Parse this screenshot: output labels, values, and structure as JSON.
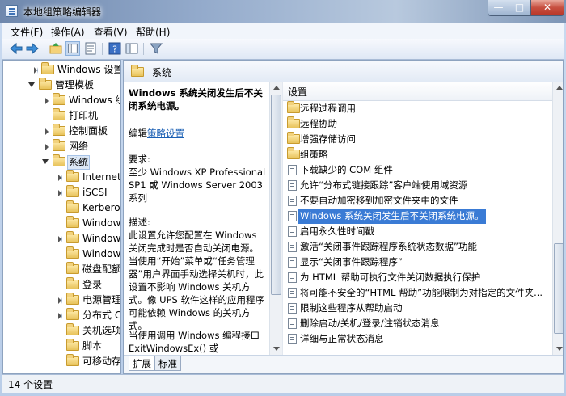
{
  "window": {
    "title": "本地组策略编辑器"
  },
  "menu": [
    {
      "label": "文件(F)"
    },
    {
      "label": "操作(A)"
    },
    {
      "label": "查看(V)"
    },
    {
      "label": "帮助(H)"
    }
  ],
  "toolbar": {
    "icons": [
      "back-arrow-icon",
      "forward-arrow-icon",
      "up-folder-icon",
      "show-tree-icon",
      "properties-icon",
      "help-icon",
      "extended-view-icon",
      "filter-icon"
    ]
  },
  "tree": {
    "items": [
      {
        "label": "Windows 设置",
        "expanded": false
      },
      {
        "label": "管理模板",
        "expanded": true
      },
      {
        "label": "Windows 组件"
      },
      {
        "label": "打印机"
      },
      {
        "label": "控制面板"
      },
      {
        "label": "网络"
      },
      {
        "label": "系统",
        "selected": true
      },
      {
        "label": "Internet 通信管理"
      },
      {
        "label": "iSCSI"
      },
      {
        "label": "Kerberos"
      },
      {
        "label": "Windows 文件保护"
      },
      {
        "label": "Windows 时间服务"
      },
      {
        "label": "Windows HotStart"
      },
      {
        "label": "磁盘配额"
      },
      {
        "label": "登录"
      },
      {
        "label": "电源管理"
      },
      {
        "label": "分布式 COM"
      },
      {
        "label": "关机选项"
      },
      {
        "label": "脚本"
      },
      {
        "label": "可移动存储访问"
      }
    ]
  },
  "content": {
    "header": "系统",
    "description": {
      "title": "Windows 系统关闭发生后不关闭系统电源。",
      "edit_prefix": "编辑",
      "edit_link": "策略设置",
      "req_label": "要求:",
      "req_text": "至少 Windows XP Professional SP1 或 Windows Server 2003 系列",
      "desc_label": "描述:",
      "desc_text": "此设置允许您配置在 Windows 关闭完成时是否自动关闭电源。当使用“开始”菜单或“任务管理器”用户界面手动选择关机时，此设置不影响 Windows 关机方式。像 UPS 软件这样的应用程序可能依赖 Windows 的关机方式。",
      "extra_text": "当使用调用 Windows 编程接口 ExitWindowsEx() 或 InitiateSystemShutdown() 的软件"
    },
    "list_header": "设置",
    "settings": [
      {
        "type": "folder",
        "label": "远程过程调用"
      },
      {
        "type": "folder",
        "label": "远程协助"
      },
      {
        "type": "folder",
        "label": "增强存储访问"
      },
      {
        "type": "folder",
        "label": "组策略"
      },
      {
        "type": "policy",
        "label": "下载缺少的 COM 组件"
      },
      {
        "type": "policy",
        "label": "允许“分布式链接跟踪”客户端使用域资源"
      },
      {
        "type": "policy",
        "label": "不要自动加密移到加密文件夹中的文件"
      },
      {
        "type": "policy",
        "label": "Windows 系统关闭发生后不关闭系统电源。",
        "selected": true
      },
      {
        "type": "policy",
        "label": "启用永久性时间戳"
      },
      {
        "type": "policy",
        "label": "激活“关闭事件跟踪程序系统状态数据”功能"
      },
      {
        "type": "policy",
        "label": "显示“关闭事件跟踪程序”"
      },
      {
        "type": "policy",
        "label": "为 HTML 帮助可执行文件关闭数据执行保护"
      },
      {
        "type": "policy",
        "label": "将可能不安全的“HTML 帮助”功能限制为对指定的文件夹..."
      },
      {
        "type": "policy",
        "label": "限制这些程序从帮助启动"
      },
      {
        "type": "policy",
        "label": "删除启动/关机/登录/注销状态消息"
      },
      {
        "type": "policy",
        "label": "详细与正常状态消息"
      }
    ],
    "tabs": [
      {
        "label": "扩展",
        "active": true
      },
      {
        "label": "标准",
        "active": false
      }
    ]
  },
  "status": {
    "text": "14 个设置"
  },
  "colors": {
    "selection": "#3a7bd5",
    "link": "#1a5fb4",
    "frame": "#b9cde8"
  }
}
